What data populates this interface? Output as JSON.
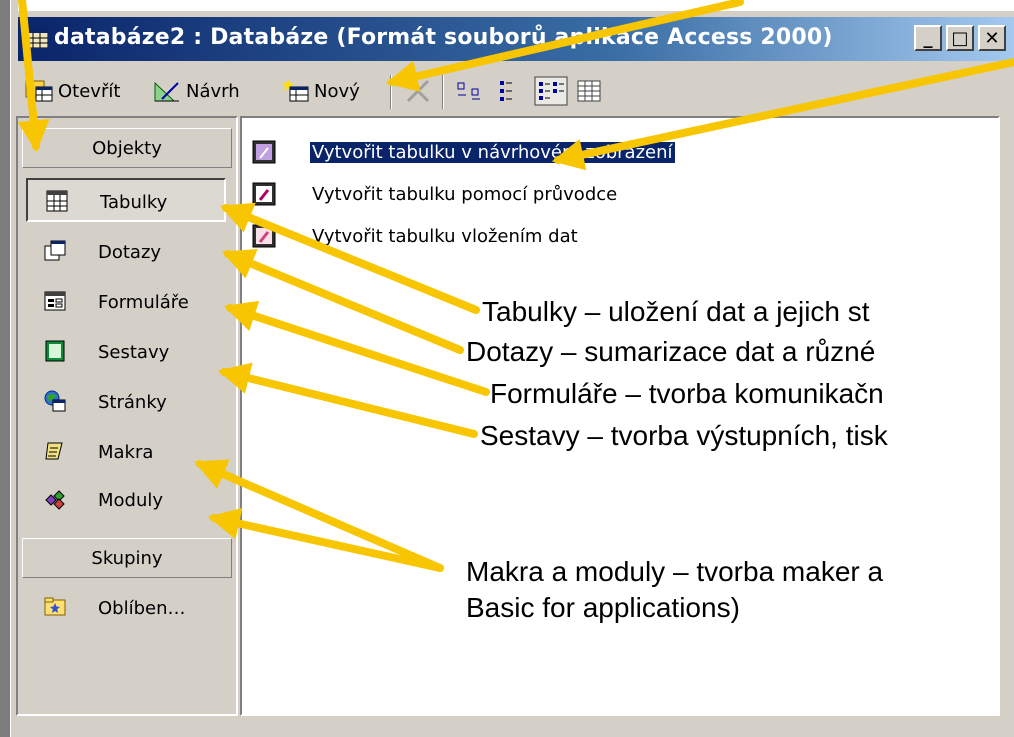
{
  "window": {
    "title": "databáze2 : Databáze (Formát souborů aplikace Access 2000)",
    "buttons": [
      "_",
      "□",
      "✕"
    ]
  },
  "toolbar": {
    "open_label": "Otevřít",
    "design_label": "Návrh",
    "new_label": "Nový"
  },
  "sidebar": {
    "objects_header": "Objekty",
    "groups_header": "Skupiny",
    "items": [
      {
        "label": "Tabulky",
        "icon": "table-icon"
      },
      {
        "label": "Dotazy",
        "icon": "query-icon"
      },
      {
        "label": "Formuláře",
        "icon": "form-icon"
      },
      {
        "label": "Sestavy",
        "icon": "report-icon"
      },
      {
        "label": "Stránky",
        "icon": "page-icon"
      },
      {
        "label": "Makra",
        "icon": "macro-icon"
      },
      {
        "label": "Moduly",
        "icon": "module-icon"
      }
    ],
    "groups": [
      {
        "label": "Oblíben…",
        "icon": "favorites-folder-icon"
      }
    ]
  },
  "list": {
    "items": [
      {
        "label": "Vytvořit tabulku v návrhovém zobrazení"
      },
      {
        "label": "Vytvořit tabulku pomocí průvodce"
      },
      {
        "label": "Vytvořit tabulku vložením dat"
      }
    ]
  },
  "annotations": {
    "tabulky": "Tabulky – uložení dat a jejich st",
    "dotazy": "Dotazy – sumarizace dat a různé",
    "formulare": "Formuláře – tvorba komunikačn",
    "sestavy": "Sestavy – tvorba výstupních, tisk",
    "makra_line1": "Makra a moduly – tvorba maker a",
    "makra_line2": "Basic for applications)"
  },
  "colors": {
    "arrow": "#f7c600",
    "titlebar": "#0a246a",
    "selection": "#0a246a"
  }
}
